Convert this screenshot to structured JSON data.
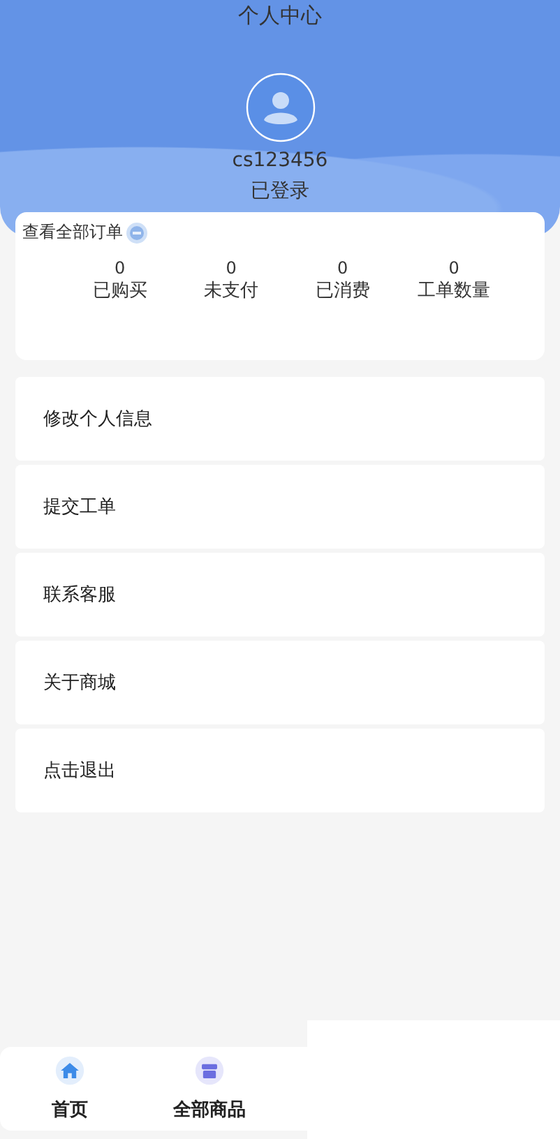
{
  "header": {
    "title": "个人中心",
    "username": "cs123456",
    "status": "已登录"
  },
  "orders": {
    "link": "查看全部订单",
    "stats": [
      {
        "value": "0",
        "label": "已购买"
      },
      {
        "value": "0",
        "label": "未支付"
      },
      {
        "value": "0",
        "label": "已消费"
      },
      {
        "value": "0",
        "label": "工单数量"
      }
    ]
  },
  "menu": [
    "修改个人信息",
    "提交工单",
    "联系客服",
    "关于商城",
    "点击退出"
  ],
  "nav": [
    {
      "kind": "home",
      "label": "首页"
    },
    {
      "kind": "shop",
      "label": "全部商品"
    }
  ]
}
